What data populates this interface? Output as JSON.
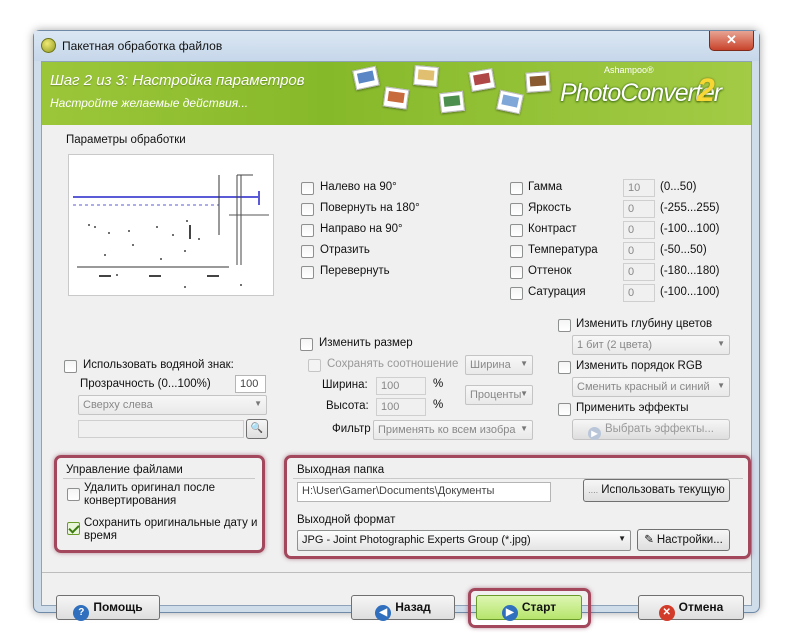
{
  "window": {
    "title": "Пакетная обработка файлов",
    "close_glyph": "✕"
  },
  "banner": {
    "step_title": "Шаг 2 из 3: Настройка параметров",
    "step_subtitle": "Настройте желаемые действия...",
    "brand_small": "Ashampoo®",
    "brand_name": "PhotoConverter",
    "brand_version": "2"
  },
  "preview": {
    "label": "Параметры обработки"
  },
  "watermark": {
    "checkbox_label": "Использовать водяной знак:",
    "opacity_label": "Прозрачность (0...100%)",
    "opacity_value": "100",
    "position_value": "Сверху слева",
    "file_value": ""
  },
  "transform": {
    "items": [
      "Налево на 90°",
      "Повернуть на 180°",
      "Направо на 90°",
      "Отразить",
      "Перевернуть"
    ]
  },
  "adjust": {
    "items": [
      {
        "label": "Гамма",
        "value": "10",
        "range": "(0...50)"
      },
      {
        "label": "Яркость",
        "value": "0",
        "range": "(-255...255)"
      },
      {
        "label": "Контраст",
        "value": "0",
        "range": "(-100...100)"
      },
      {
        "label": "Температура",
        "value": "0",
        "range": "(-50...50)"
      },
      {
        "label": "Оттенок",
        "value": "0",
        "range": "(-180...180)"
      },
      {
        "label": "Сатурация",
        "value": "0",
        "range": "(-100...100)"
      }
    ]
  },
  "resize": {
    "checkbox_label": "Изменить размер",
    "keep_ratio_label": "Сохранять соотношение",
    "ratio_mode": "Ширина",
    "width_label": "Ширина:",
    "width_value": "100",
    "height_label": "Высота:",
    "height_value": "100",
    "unit": "%",
    "unit_mode": "Проценты",
    "filter_label": "Фильтр",
    "filter_value": "Применять ко всем изобра"
  },
  "color": {
    "depth_label": "Изменить глубину цветов",
    "depth_value": "1 бит (2 цвета)",
    "rgb_label": "Изменить порядок RGB",
    "rgb_value": "Сменить красный и синий",
    "effects_label": "Применить эффекты",
    "effects_button": "Выбрать эффекты..."
  },
  "file_management": {
    "title": "Управление файлами",
    "delete_label": "Удалить оригинал после конвертирования",
    "keep_dates_label": "Сохранить оригинальные дату и время"
  },
  "output": {
    "folder_label": "Выходная папка",
    "folder_value": "H:\\User\\Gamer\\Documents\\Документы",
    "use_current_button": "Использовать текущую",
    "format_label": "Выходной формат",
    "format_value": "JPG - Joint Photographic Experts Group (*.jpg)",
    "settings_button": "Настройки..."
  },
  "footer": {
    "help": "Помощь",
    "back": "Назад",
    "start": "Старт",
    "cancel": "Отмена"
  },
  "colors": {
    "accent_green": "#8cbe2e",
    "highlight": "#a2475c"
  }
}
